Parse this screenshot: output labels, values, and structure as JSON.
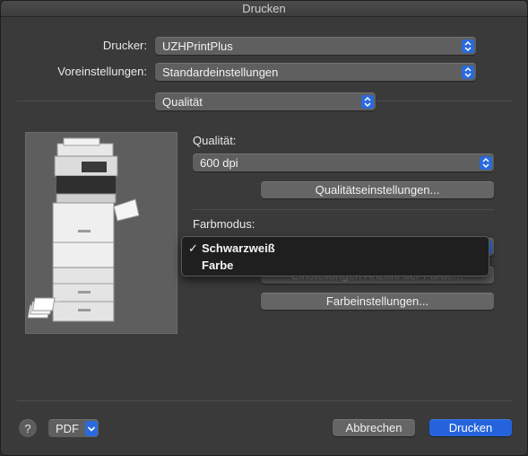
{
  "window": {
    "title": "Drucken"
  },
  "printer": {
    "label": "Drucker:",
    "value": "UZHPrintPlus"
  },
  "presets": {
    "label": "Voreinstellungen:",
    "value": "Standardeinstellungen"
  },
  "section": {
    "value": "Qualität"
  },
  "quality": {
    "label": "Qualität:",
    "value": "600 dpi",
    "settings_button": "Qualitätseinstellungen..."
  },
  "color_mode": {
    "label": "Farbmodus:",
    "menu_items": [
      {
        "label": "Schwarzweiß",
        "checked": true
      },
      {
        "label": "Farbe",
        "checked": false
      }
    ],
    "obscured_button": "Einstellungen Anzahl der Farbe...",
    "color_settings_button": "Farbeinstellungen..."
  },
  "footer": {
    "help": "?",
    "pdf": "PDF",
    "cancel": "Abbrechen",
    "print": "Drucken"
  },
  "colors": {
    "accent": "#2563dc",
    "window": "#3a3a3a"
  }
}
